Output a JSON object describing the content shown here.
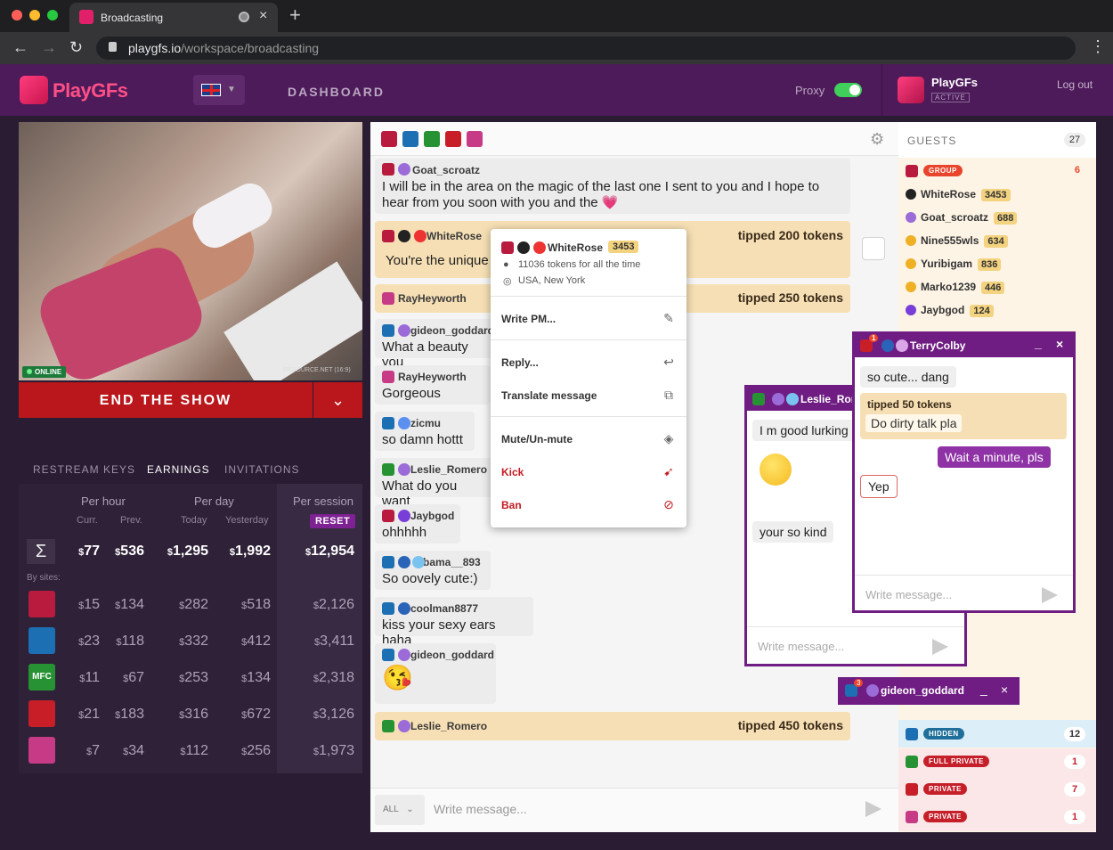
{
  "browser": {
    "tab_title": "Broadcasting",
    "url_host": "playgfs.io",
    "url_path": "/workspace/broadcasting"
  },
  "header": {
    "logo": "PlayGFs",
    "dashboard": "DASHBOARD",
    "proxy": "Proxy",
    "account_name": "PlayGFs",
    "account_status": "ACTIVE",
    "logout": "Log out",
    "lang_icon": "uk-flag-icon"
  },
  "stream": {
    "online": "ONLINE",
    "resolution": "RESOURCE.NET (16:9)",
    "end_show": "END THE SHOW"
  },
  "left_tabs": [
    "RESTREAM KEYS",
    "EARNINGS",
    "INVITATIONS"
  ],
  "earnings": {
    "headers": {
      "per_hour": "Per hour",
      "per_day": "Per day",
      "per_session": "Per session"
    },
    "subheaders": {
      "curr": "Curr.",
      "prev": "Prev.",
      "today": "Today",
      "yesterday": "Yesterday",
      "reset": "RESET"
    },
    "total": {
      "sigma": "Σ",
      "curr": "77",
      "prev": "536",
      "today": "1,295",
      "yesterday": "1,992",
      "session": "12,954"
    },
    "by_sites_label": "By sites:",
    "sites": [
      {
        "icon": "chaturbate-icon",
        "color": "#b81b3e",
        "curr": "15",
        "prev": "134",
        "today": "282",
        "yesterday": "518",
        "session": "2,126"
      },
      {
        "icon": "camsoda-icon",
        "color": "#1c6fb3",
        "curr": "23",
        "prev": "118",
        "today": "332",
        "yesterday": "412",
        "session": "3,411"
      },
      {
        "icon": "mfc-icon",
        "color": "#279233",
        "curr": "11",
        "prev": "67",
        "today": "253",
        "yesterday": "134",
        "session": "2,318"
      },
      {
        "icon": "stripchat-icon",
        "color": "#c71e27",
        "curr": "21",
        "prev": "183",
        "today": "316",
        "yesterday": "672",
        "session": "3,126"
      },
      {
        "icon": "cam4-icon",
        "color": "#c73a86",
        "curr": "7",
        "prev": "34",
        "today": "112",
        "yesterday": "256",
        "session": "1,973"
      }
    ]
  },
  "chat": {
    "messages": [
      {
        "user": "Goat_scroatz",
        "text": "I will be in the area on the magic of the last one I sent to you and I hope to"
      },
      {
        "text2": "hear from you soon with you and the 💗"
      },
      {
        "user": "WhiteRose",
        "text": "You're the unique",
        "tip": "tipped 200 tokens"
      },
      {
        "user": "RayHeyworth",
        "tip": "tipped 250 tokens"
      },
      {
        "user": "gideon_goddard",
        "text": "What a beauty you"
      },
      {
        "user": "RayHeyworth",
        "text": "Gorgeous"
      },
      {
        "user": "zicmu",
        "text": "so damn hottt"
      },
      {
        "user": "Leslie_Romero",
        "text": "What do you want"
      },
      {
        "user": "Jaybgod",
        "text": "ohhhhh"
      },
      {
        "user": "bama__893",
        "text": "So oovely cute:)"
      },
      {
        "user": "coolman8877",
        "text": "kiss your sexy ears haha"
      },
      {
        "user": "gideon_goddard",
        "text": "😘"
      },
      {
        "user": "Leslie_Romero",
        "tip": "tipped 450 tokens"
      }
    ],
    "filter": "ALL",
    "placeholder": "Write message..."
  },
  "popup": {
    "user": "WhiteRose",
    "count": "3453",
    "tokens": "11036 tokens for all the time",
    "location": "USA, New York",
    "items": [
      "Write PM...",
      "Reply...",
      "Translate message",
      "Mute/Un-mute",
      "Kick",
      "Ban"
    ]
  },
  "guests": {
    "title": "GUESTS",
    "count": "27",
    "groups": [
      {
        "label": "GROUP",
        "count": "6",
        "color": "#e8452c"
      },
      {
        "label": "HIDDEN",
        "count": "12",
        "color": "#1f6f9a"
      },
      {
        "label": "FULL PRIVATE",
        "count": "1",
        "color": "#c51f2a"
      },
      {
        "label": "PRIVATE",
        "count": "7",
        "color": "#c51f2a"
      },
      {
        "label": "PRIVATE",
        "count": "1",
        "color": "#c51f2a"
      }
    ],
    "users": [
      {
        "name": "WhiteRose",
        "count": "3453"
      },
      {
        "name": "Goat_scroatz",
        "count": "688"
      },
      {
        "name": "Nine555wls",
        "count": "634"
      },
      {
        "name": "Yuribigam",
        "count": "836"
      },
      {
        "name": "Marko1239",
        "count": "446"
      },
      {
        "name": "Jaybgod",
        "count": "124"
      }
    ]
  },
  "pm1": {
    "user": "Leslie_Ror",
    "msgs": [
      "I m good lurking",
      "😍",
      "your so kind"
    ],
    "placeholder": "Write message..."
  },
  "pm2": {
    "user": "TerryColby",
    "badge": "1",
    "msgs": [
      "so cute... dang",
      "Do dirty talk pla",
      "Wait a minute, pls",
      "Yep"
    ],
    "tip": "tipped 50 tokens",
    "placeholder": "Write message..."
  },
  "pm3": {
    "user": "gideon_goddard",
    "badge": "3"
  }
}
